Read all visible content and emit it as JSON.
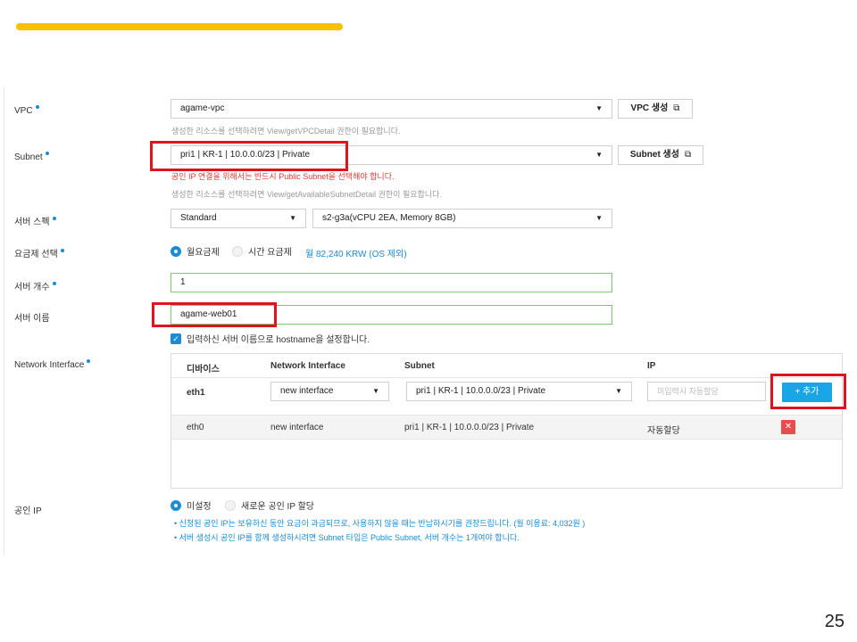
{
  "vpc": {
    "label": "VPC",
    "value": "agame-vpc",
    "create_button": "VPC 생성",
    "help": "생성한 리소스를 선택하려면 View/getVPCDetail 권한이 필요합니다."
  },
  "subnet": {
    "label": "Subnet",
    "value": "pri1 | KR-1 | 10.0.0.0/23 | Private",
    "create_button": "Subnet 생성",
    "warning": "공인 IP 연결을 위해서는 반드시 Public Subnet을 선택해야 합니다.",
    "help": "생성한 리소스를 선택하려면 View/getAvailableSubnetDetail 권한이 필요합니다."
  },
  "server_spec": {
    "label": "서버 스펙",
    "type_value": "Standard",
    "spec_value": "s2-g3a(vCPU 2EA, Memory 8GB)"
  },
  "billing": {
    "label": "요금제 선택",
    "options": [
      "월요금제",
      "시간 요금제"
    ],
    "selected": 0,
    "price": "월 82,240 KRW (OS 제외)"
  },
  "server_count": {
    "label": "서버 개수",
    "value": "1"
  },
  "server_name": {
    "label": "서버 이름",
    "value": "agame-web01",
    "hostname_checkbox": "입력하신 서버 이름으로 hostname을 설정합니다."
  },
  "network_interface": {
    "label": "Network Interface",
    "columns": [
      "디바이스",
      "Network Interface",
      "Subnet",
      "IP"
    ],
    "edit_row": {
      "device": "eth1",
      "interface": "new interface",
      "subnet": "pri1 | KR-1 | 10.0.0.0/23 | Private",
      "ip_placeholder": "미입력시 자동할당",
      "add_button": "+ 추가"
    },
    "rows": [
      {
        "device": "eth0",
        "interface": "new interface",
        "subnet": "pri1 | KR-1 | 10.0.0.0/23 | Private",
        "ip": "자동할당",
        "delete": "✕"
      }
    ]
  },
  "public_ip": {
    "label": "공인 IP",
    "options": [
      "미설정",
      "새로운 공인 IP 할당"
    ],
    "selected": 0,
    "notes": [
      "신청된 공인 IP는 보유하신 동안 요금이 과금되므로, 사용하지 않을 때는 반납하시기를 권장드립니다. (월 이용료: 4,032원 )",
      "서버 생성시 공인 IP를 함께 생성하시려면 Subnet 타입은 Public Subnet, 서버 개수는 1개여야 합니다."
    ]
  },
  "page_number": "25",
  "colors": {
    "accent_bar": "#f5c100",
    "highlight": "#e0141e",
    "primary": "#1a8bd6"
  }
}
